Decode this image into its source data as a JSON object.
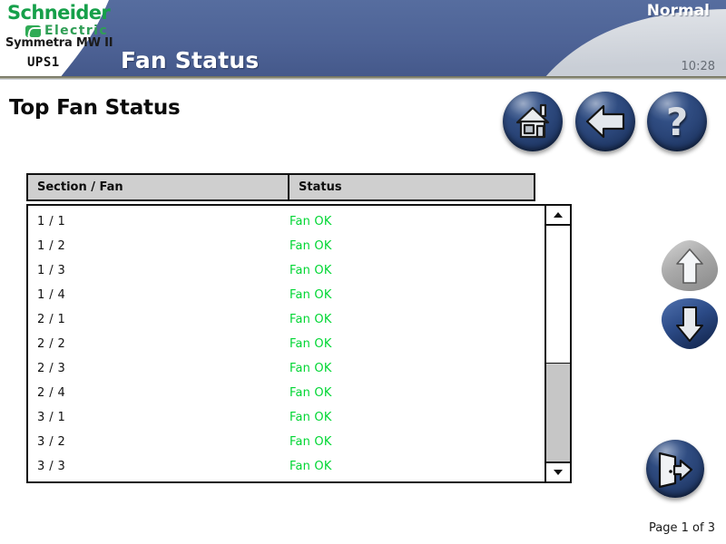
{
  "header": {
    "brand_line1": "Schneider",
    "brand_line2": "Electric",
    "brand_mark_icon": "schneider-swoosh-icon",
    "model": "Symmetra MW II",
    "unit_label": "UPS1",
    "title": "Fan Status",
    "status": "Normal",
    "clock": "10:28",
    "blue": "#4e6396",
    "green": "#2fab55"
  },
  "page": {
    "title": "Top Fan Status",
    "indicator": "Page 1 of 3"
  },
  "nav": {
    "home_label": "Home",
    "home_icon": "home-icon",
    "back_label": "Back",
    "back_icon": "back-arrow-icon",
    "help_label": "Help",
    "help_icon": "question-mark-icon",
    "help_glyph": "?",
    "exit_label": "Exit",
    "exit_icon": "exit-door-icon",
    "scroll_up_label": "Scroll Up",
    "scroll_up_icon": "arrow-up-icon",
    "scroll_down_label": "Scroll Down",
    "scroll_down_icon": "arrow-down-icon"
  },
  "table": {
    "columns": [
      "Section / Fan",
      "Status"
    ],
    "rows": [
      {
        "section": "1 / 1",
        "status": "Fan OK"
      },
      {
        "section": "1 / 2",
        "status": "Fan OK"
      },
      {
        "section": "1 / 3",
        "status": "Fan OK"
      },
      {
        "section": "1 / 4",
        "status": "Fan OK"
      },
      {
        "section": "2 / 1",
        "status": "Fan OK"
      },
      {
        "section": "2 / 2",
        "status": "Fan OK"
      },
      {
        "section": "2 / 3",
        "status": "Fan OK"
      },
      {
        "section": "2 / 4",
        "status": "Fan OK"
      },
      {
        "section": "3 / 1",
        "status": "Fan OK"
      },
      {
        "section": "3 / 2",
        "status": "Fan OK"
      },
      {
        "section": "3 / 3",
        "status": "Fan OK"
      }
    ],
    "status_ok_color": "#00d633"
  },
  "scrollbar": {
    "up_icon": "scroll-arrow-up-icon",
    "down_icon": "scroll-arrow-down-icon"
  }
}
